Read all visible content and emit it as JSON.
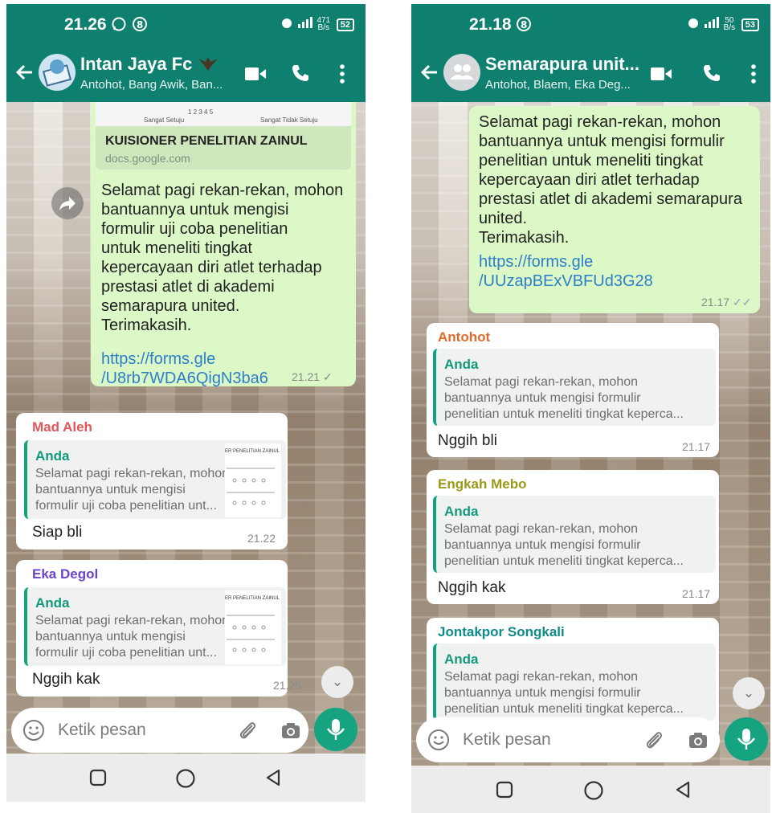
{
  "left_phone": {
    "status": {
      "time": "21.26",
      "speed_value": "471",
      "speed_unit": "B/s",
      "battery": "52"
    },
    "header": {
      "title": "Intan Jaya Fc",
      "subtitle": "Antohot, Bang Awik, Ban..."
    },
    "link_preview": {
      "title": "KUISIONER PENELITIAN ZAINUL",
      "domain": "docs.google.com",
      "scale": "1  2  3  4  5",
      "scale_low": "Sangat Setuju",
      "scale_high": "Sangat Tidak Setuju"
    },
    "outgoing": {
      "text": "Selamat pagi rekan-rekan, mohon\nbantuannya untuk mengisi\nformulir uji coba  penelitian\nuntuk meneliti tingkat\nkepercayaan diri atlet terhadap\nprestasi atlet di akademi\nsemarapura united.\nTerimakasih.",
      "link": "https://forms.gle\n/U8rb7WDA6QigN3ba6",
      "time": "21.21",
      "tick": "✓"
    },
    "replies": [
      {
        "sender": "Mad Aleh",
        "quote_author": "Anda",
        "quote_text": "Selamat pagi rekan-rekan, mohon\nbantuannya untuk mengisi\nformulir uji coba  penelitian unt...",
        "thumb_title": "ER PENELITIAN ZAINUL",
        "text": "Siap bli",
        "time": "21.22"
      },
      {
        "sender": "Eka Degol",
        "quote_author": "Anda",
        "quote_text": "Selamat pagi rekan-rekan, mohon\nbantuannya untuk mengisi\nformulir uji coba  penelitian unt...",
        "thumb_title": "ER PENELITIAN ZAINUL",
        "text": "Nggih kak",
        "time": "21.25"
      }
    ],
    "input_placeholder": "Ketik pesan"
  },
  "right_phone": {
    "status": {
      "time": "21.18",
      "speed_value": "50",
      "speed_unit": "B/s",
      "battery": "53"
    },
    "header": {
      "title": "Semarapura unit...",
      "subtitle": "Antohot, Blaem, Eka Deg..."
    },
    "outgoing": {
      "text": "Selamat pagi rekan-rekan, mohon\nbantuannya untuk mengisi formulir\npenelitian untuk meneliti tingkat\nkepercayaan diri atlet terhadap\nprestasi atlet di akademi semarapura\nunited.\nTerimakasih.",
      "link": "https://forms.gle\n/UUzapBExVBFUd3G28",
      "time": "21.17",
      "tick": "✓✓"
    },
    "replies": [
      {
        "sender": "Antohot",
        "quote_author": "Anda",
        "quote_text": "Selamat pagi rekan-rekan, mohon\nbantuannya untuk mengisi formulir\npenelitian untuk meneliti tingkat keperca...",
        "text": "Nggih bli",
        "time": "21.17"
      },
      {
        "sender": "Engkah Mebo",
        "quote_author": "Anda",
        "quote_text": "Selamat pagi rekan-rekan, mohon\nbantuannya untuk mengisi formulir\npenelitian untuk meneliti tingkat keperca...",
        "text": "Nggih kak",
        "time": "21.17"
      },
      {
        "sender": "Jontakpor Songkali",
        "quote_author": "Anda",
        "quote_text": "Selamat pagi rekan-rekan, mohon\nbantuannya untuk mengisi formulir\npenelitian untuk meneliti tingkat keperca...",
        "text": "",
        "time": ""
      }
    ],
    "input_placeholder": "Ketik pesan"
  },
  "colors": {
    "header": "#0f7f6f",
    "outgoing_bubble": "#dcf8c6",
    "link": "#2c7fc8",
    "accent_green": "#16a37f",
    "sender_red": "#e0575b",
    "sender_purple": "#6a45c9",
    "sender_orange": "#e06a2a",
    "sender_olive": "#9a9a1a",
    "sender_teal": "#0f8a8a"
  },
  "icons": [
    "back-arrow-icon",
    "group-avatar",
    "video-call-icon",
    "voice-call-icon",
    "more-options-icon",
    "forward-icon",
    "emoji-icon",
    "attach-icon",
    "camera-icon",
    "mic-icon",
    "scroll-down-icon",
    "nav-recent-icon",
    "nav-home-icon",
    "nav-back-icon"
  ]
}
